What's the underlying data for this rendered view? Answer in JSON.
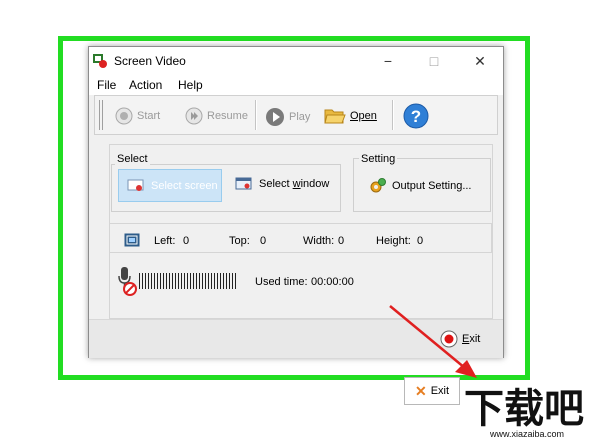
{
  "window": {
    "title": "Screen Video",
    "minimize": "−",
    "maximize": "□",
    "close": "✕"
  },
  "menu": [
    "File",
    "Action",
    "Help"
  ],
  "toolbar": {
    "start": "Start",
    "resume": "Resume",
    "play": "Play",
    "open": "Open"
  },
  "select_group": {
    "label": "Select",
    "select_screen": "Select screen",
    "select_window": "Select window"
  },
  "setting_group": {
    "label": "Setting",
    "output_setting": "Output Setting..."
  },
  "coords": {
    "left_label": "Left:",
    "left": "0",
    "top_label": "Top:",
    "top": "0",
    "width_label": "Width:",
    "width": "0",
    "height_label": "Height:",
    "height": "0"
  },
  "status": {
    "used_time_label": "Used time:",
    "used_time": "00:00:00"
  },
  "exit_button": "Exit",
  "tooltip_exit": "Exit",
  "watermark": {
    "brand": "下载吧",
    "url": "www.xiazaiba.com"
  },
  "colors": {
    "highlight_frame": "#22dd22",
    "arrow": "#e02020",
    "selected_bg": "#cce4f7"
  }
}
